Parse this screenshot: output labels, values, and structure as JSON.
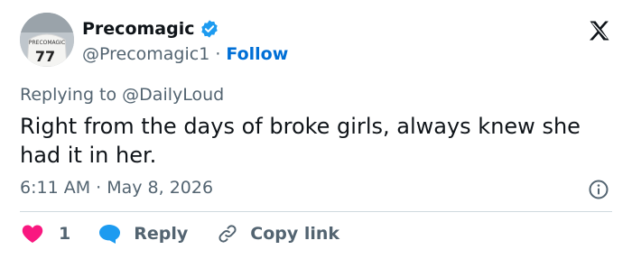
{
  "author": {
    "display_name": "Precomagic",
    "handle": "@Precomagic1",
    "follow_label": "Follow",
    "separator": "·",
    "avatar_jersey_text": "PRECOMAGIC",
    "avatar_jersey_number": "77"
  },
  "reply": {
    "prefix": "Replying to",
    "mention": "@DailyLoud"
  },
  "tweet": {
    "text": "Right from the days of broke girls, always knew she had it in her.",
    "timestamp": "6:11 AM · May 8, 2026"
  },
  "actions": {
    "like_count": "1",
    "reply_label": "Reply",
    "copy_label": "Copy link"
  },
  "colors": {
    "link_blue": "#006fd6",
    "verified_blue": "#1d9bf0",
    "like_red": "#f91880",
    "muted_text": "#536471"
  }
}
